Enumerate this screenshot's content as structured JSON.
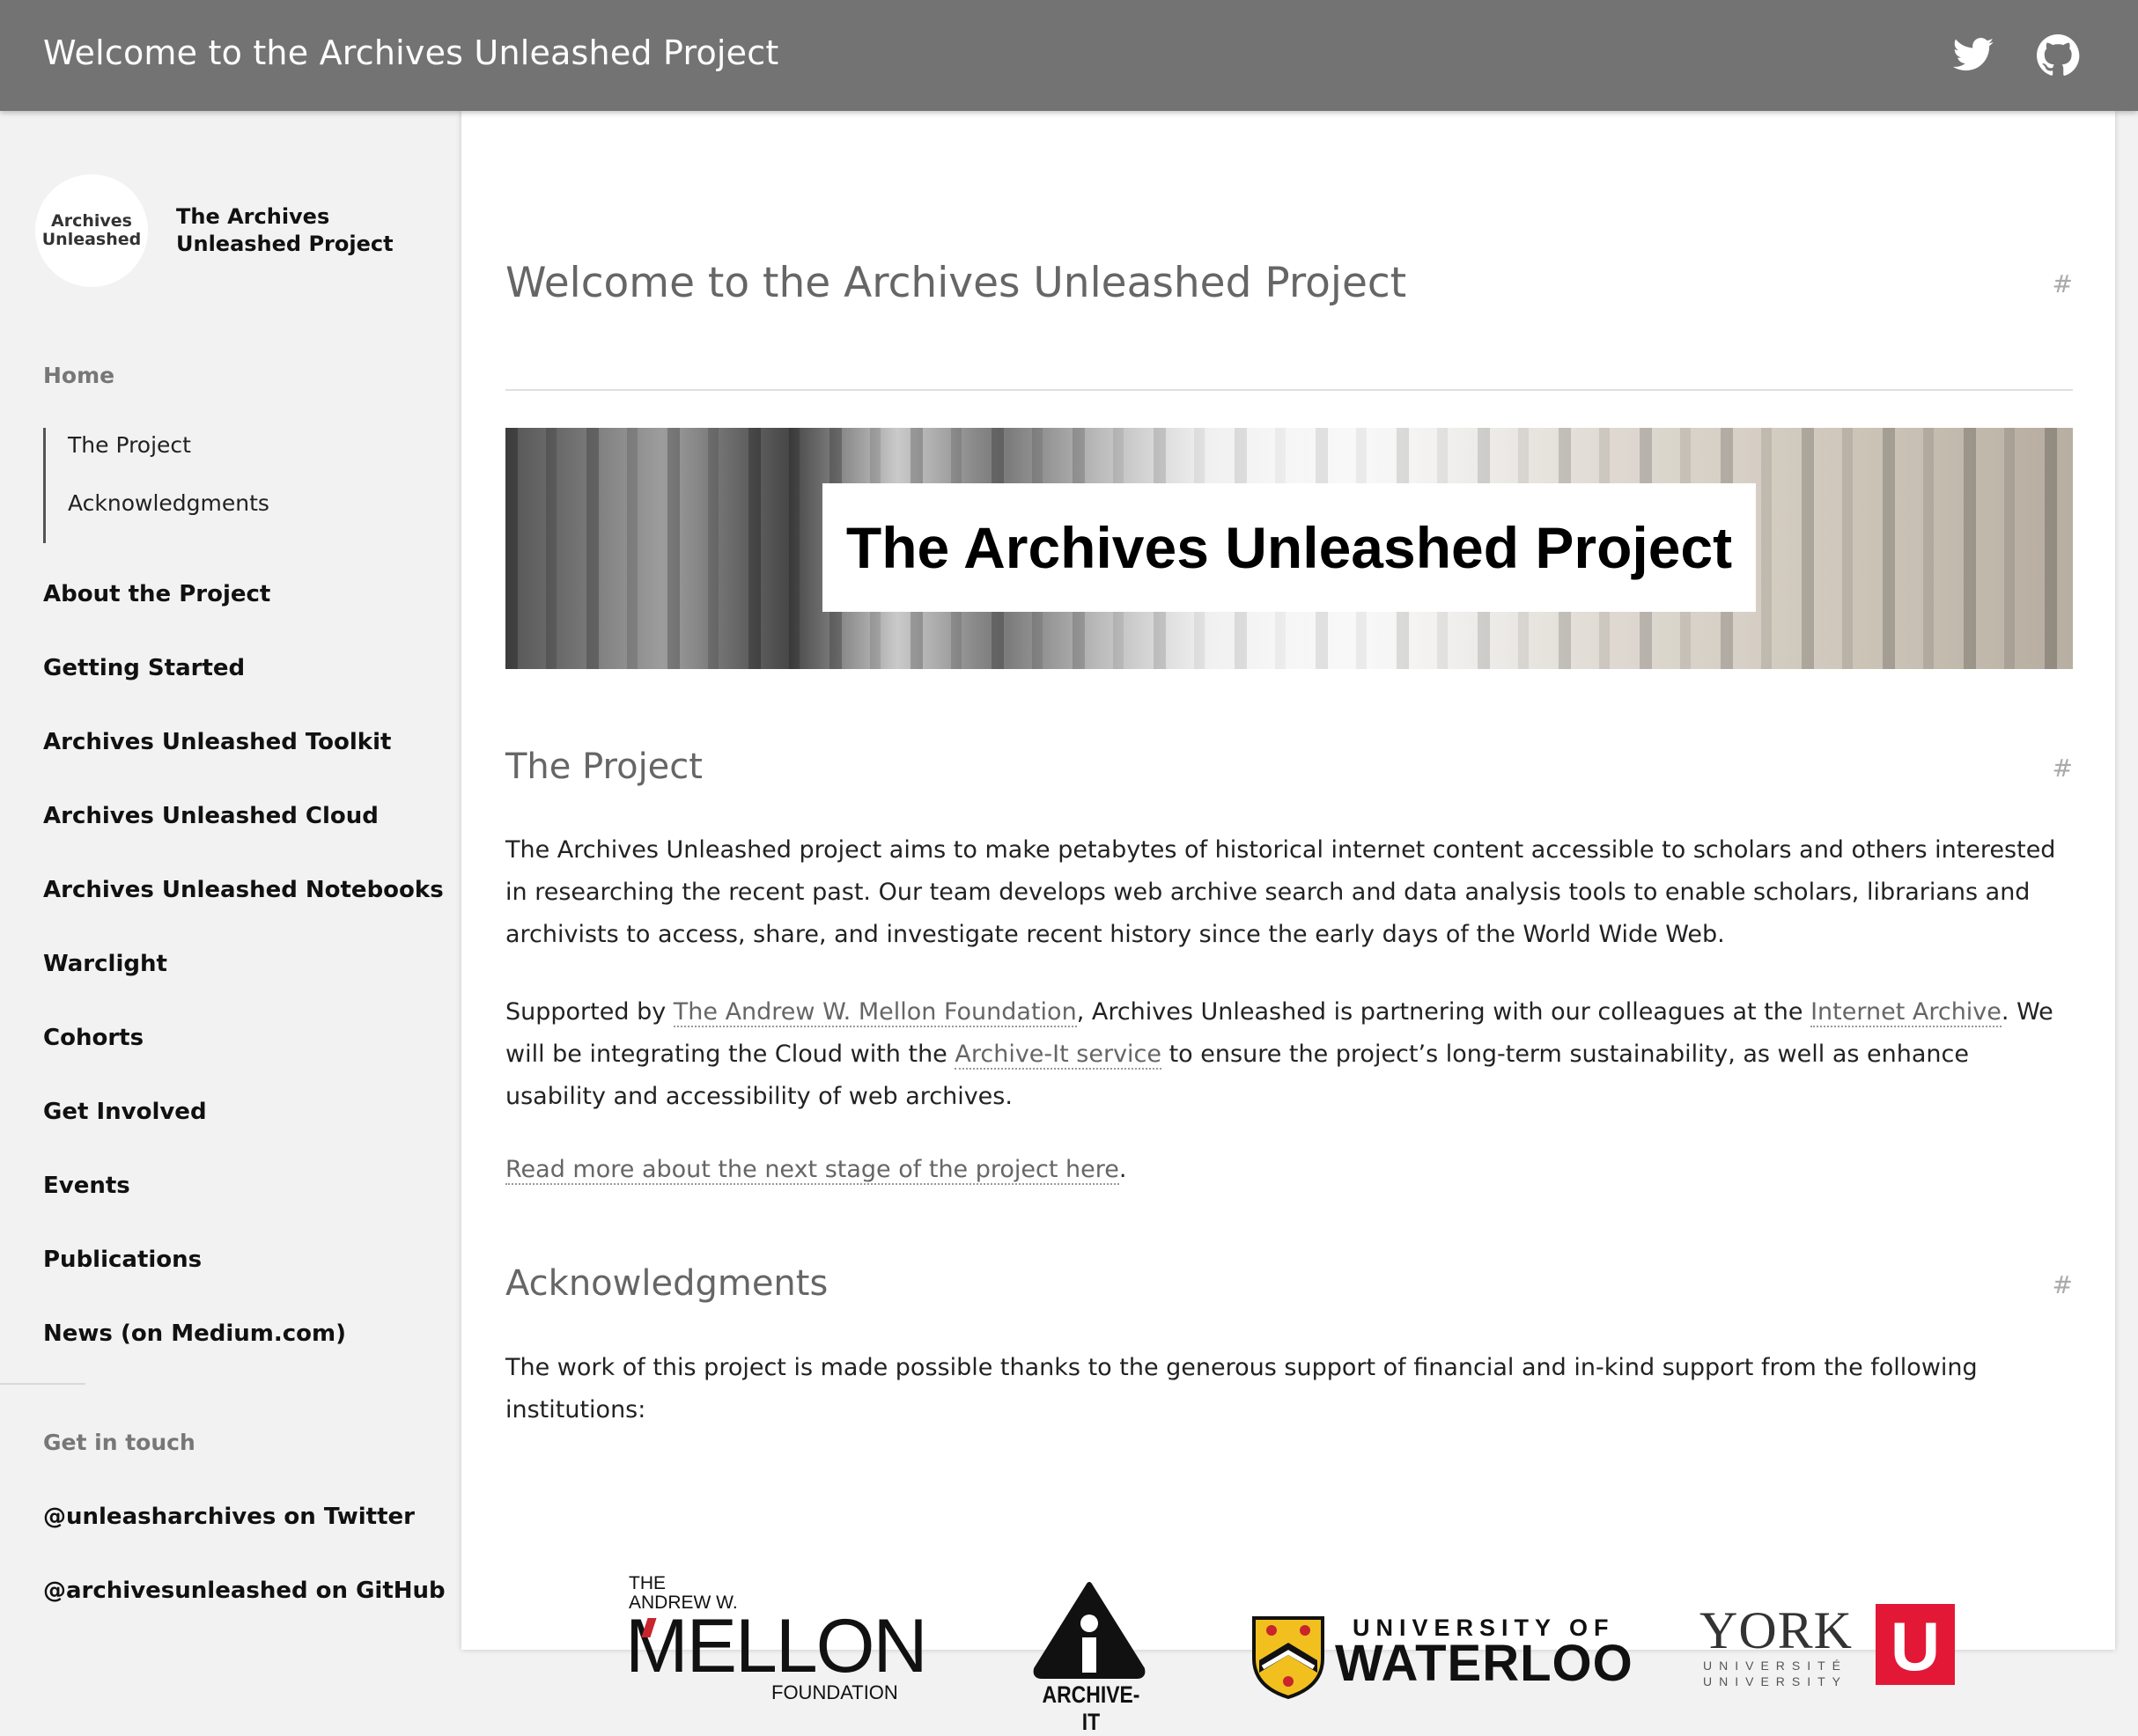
{
  "header": {
    "title": "Welcome to the Archives Unleashed Project",
    "twitter_icon": "twitter-icon",
    "github_icon": "github-icon"
  },
  "sidebar": {
    "brand_logo_line1": "Archives",
    "brand_logo_line2": "Unleashed",
    "brand_name": "The Archives Unleashed Project",
    "home": "Home",
    "sub_items": [
      "The Project",
      "Acknowledgments"
    ],
    "items": [
      "About the Project",
      "Getting Started",
      "Archives Unleashed Toolkit",
      "Archives Unleashed Cloud",
      "Archives Unleashed Notebooks",
      "Warclight",
      "Cohorts",
      "Get Involved",
      "Events",
      "Publications",
      "News (on Medium.com)"
    ],
    "get_in_touch": "Get in touch",
    "twitter_contact": "@unleasharchives on Twitter",
    "github_contact": "@archivesunleashed on GitHub"
  },
  "main": {
    "page_title": "Welcome to the Archives Unleashed Project",
    "hash": "#",
    "banner_text": "The Archives Unleashed Project",
    "project_heading": "The Project",
    "project_p1": "The Archives Unleashed project aims to make petabytes of historical internet content accessible to scholars and others interested in researching the recent past. Our team develops web archive search and data analysis tools to enable scholars, librarians and archivists to access, share, and investigate recent history since the early days of the World Wide Web.",
    "supported_prefix": "Supported by ",
    "mellon_link": "The Andrew W. Mellon Foundation",
    "supported_mid": ", Archives Unleashed is partnering with our colleagues at the ",
    "ia_link": "Internet Archive",
    "supported_mid2": ". We will be integrating the Cloud with the ",
    "archiveit_link": "Archive-It service",
    "supported_suffix": " to ensure the project’s long-term sustainability, as well as enhance usability and accessibility of web archives.",
    "read_more_link": "Read more about the next stage of the project here",
    "read_more_suffix": ".",
    "ack_heading": "Acknowledgments",
    "ack_p": "The work of this project is made possible thanks to the generous support of financial and in-kind support from the following institutions:",
    "logos": {
      "mellon_the": "THE",
      "mellon_andrew": "ANDREW W.",
      "mellon_name": "MELLON",
      "mellon_foundation": "FOUNDATION",
      "archiveit": "ARCHIVE-IT",
      "waterloo_top": "UNIVERSITY OF",
      "waterloo_name": "WATERLOO",
      "york_name": "YORK",
      "york_universite": "UNIVERSITÉ",
      "york_university": "UNIVERSITY",
      "york_u": "U"
    }
  }
}
